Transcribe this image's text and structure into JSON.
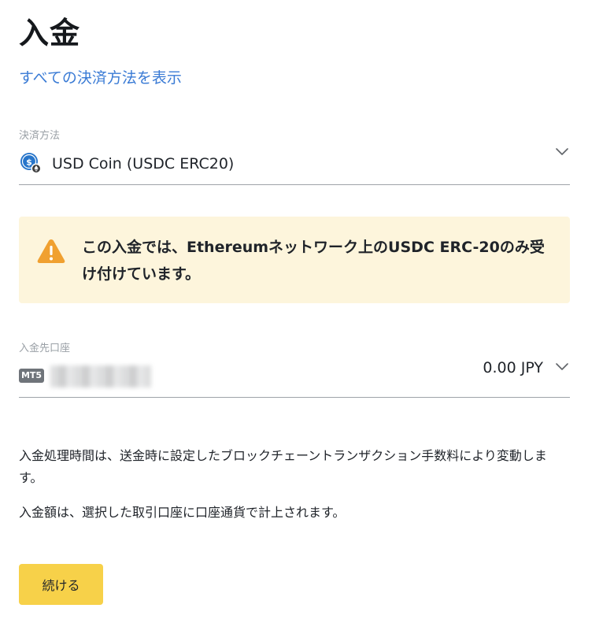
{
  "page": {
    "title": "入金",
    "all_methods_link": "すべての決済方法を表示"
  },
  "payment_method": {
    "label": "決済方法",
    "value": "USD Coin (USDC ERC20)",
    "icon": "usdc-coin-icon"
  },
  "warning": {
    "icon": "warning-triangle-icon",
    "text": "この入金では、Ethereumネットワーク上のUSDC ERC-20のみ受け付けています。",
    "color": "#fdf5dc",
    "icon_color": "#f0a030"
  },
  "deposit_account": {
    "label": "入金先口座",
    "platform_badge": "MT5",
    "balance": "0.00 JPY"
  },
  "info": {
    "processing_time": "入金処理時間は、送金時に設定したブロックチェーントランザクション手数料により変動します。",
    "currency_note": "入金額は、選択した取引口座に口座通貨で計上されます。"
  },
  "actions": {
    "continue_label": "続ける",
    "continue_color": "#f7d149"
  },
  "colors": {
    "link": "#3a7bd5",
    "text": "#1f2329",
    "muted": "#9aa0a6"
  }
}
